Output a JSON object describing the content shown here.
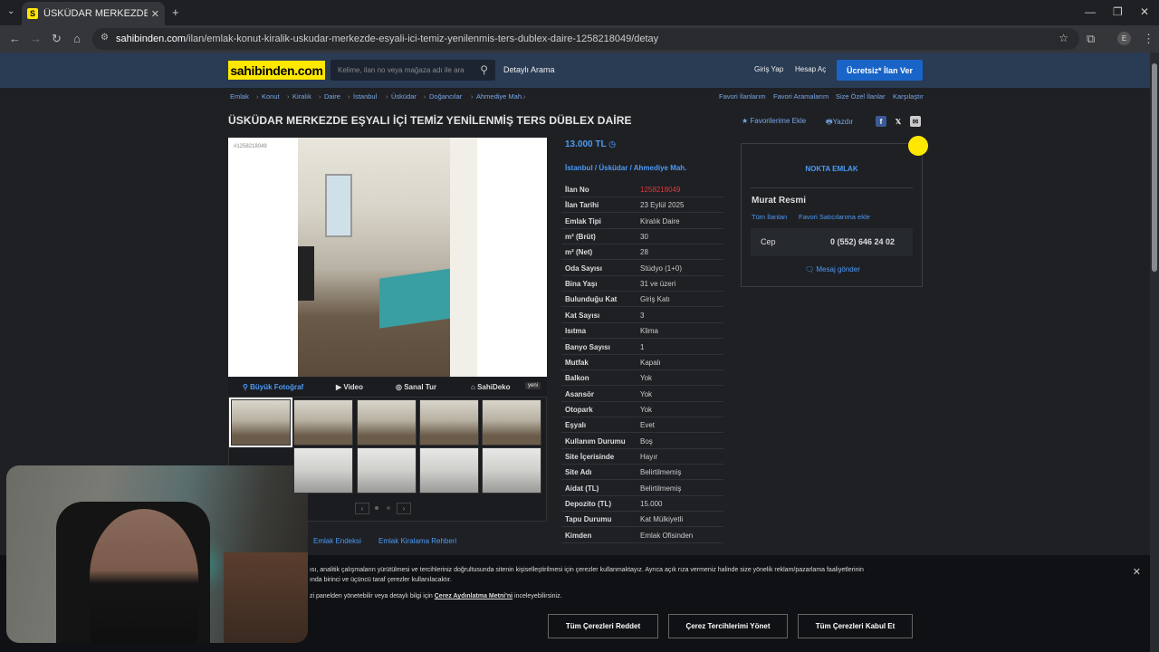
{
  "browser": {
    "tab_title": "ÜSKÜDAR MERKEZDE EŞYALI İÇ",
    "tab_favicon": "S",
    "url_host": "sahibinden.com",
    "url_path": "/ilan/emlak-konut-kiralik-uskudar-merkezde-esyali-ici-temiz-yenilenmis-ters-dublex-daire-1258218049/detay",
    "profile_initial": "E"
  },
  "header": {
    "logo": "sahibinden.com",
    "search_placeholder": "Kelime, ilan no veya mağaza adı ile ara",
    "detailed_search": "Detaylı Arama",
    "login": "Giriş Yap",
    "register": "Hesap Aç",
    "post_ad": "Ücretsiz* İlan Ver"
  },
  "breadcrumb": [
    "Emlak",
    "Konut",
    "Kiralık",
    "Daire",
    "İstanbul",
    "Üsküdar",
    "Doğancılar",
    "Ahmediye Mah."
  ],
  "breadcrumb_right": [
    "Favori İlanlarım",
    "Favori Aramalarım",
    "Size Özel İlanlar",
    "Karşılaştır"
  ],
  "listing": {
    "title": "ÜSKÜDAR MERKEZDE EŞYALI İÇİ TEMİZ YENİLENMİŞ TERS DÜBLEX DAİRE",
    "add_favorite": "Favorilerime Ekle",
    "print": "Yazdır",
    "photo_id": "#1258218049",
    "photo_tabs": {
      "big_photo": "Büyük Fotoğraf",
      "video": "Video",
      "virtual_tour": "Sanal Tur",
      "sahideko": "SahiDeko",
      "new_badge": "yeni"
    },
    "price": "13.000 TL",
    "location": [
      "İstanbul",
      "Üsküdar",
      "Ahmediye Mah."
    ],
    "details": [
      {
        "key": "İlan No",
        "value": "1258218049"
      },
      {
        "key": "İlan Tarihi",
        "value": "23 Eylül 2025"
      },
      {
        "key": "Emlak Tipi",
        "value": "Kiralık Daire"
      },
      {
        "key": "m² (Brüt)",
        "value": "30"
      },
      {
        "key": "m² (Net)",
        "value": "28"
      },
      {
        "key": "Oda Sayısı",
        "value": "Stüdyo (1+0)"
      },
      {
        "key": "Bina Yaşı",
        "value": "31 ve üzeri"
      },
      {
        "key": "Bulunduğu Kat",
        "value": "Giriş Katı"
      },
      {
        "key": "Kat Sayısı",
        "value": "3"
      },
      {
        "key": "Isıtma",
        "value": "Klima"
      },
      {
        "key": "Banyo Sayısı",
        "value": "1"
      },
      {
        "key": "Mutfak",
        "value": "Kapalı"
      },
      {
        "key": "Balkon",
        "value": "Yok"
      },
      {
        "key": "Asansör",
        "value": "Yok"
      },
      {
        "key": "Otopark",
        "value": "Yok"
      },
      {
        "key": "Eşyalı",
        "value": "Evet"
      },
      {
        "key": "Kullanım Durumu",
        "value": "Boş"
      },
      {
        "key": "Site İçerisinde",
        "value": "Hayır"
      },
      {
        "key": "Site Adı",
        "value": "Belirtilmemiş"
      },
      {
        "key": "Aidat (TL)",
        "value": "Belirtilmemiş"
      },
      {
        "key": "Depozito (TL)",
        "value": "15.000"
      },
      {
        "key": "Tapu Durumu",
        "value": "Kat Mülkiyetli"
      },
      {
        "key": "Kimden",
        "value": "Emlak Ofisinden"
      }
    ],
    "links": [
      "Emlak Endeksi",
      "Emlak Kiralama Rehberi"
    ]
  },
  "seller": {
    "store": "NOKTA EMLAK",
    "name": "Murat Resmi",
    "all_ads": "Tüm İlanları",
    "favorite_seller": "Favori Satıcılarıma ekle",
    "phone_label": "Cep",
    "phone": "0 (552) 646 24 02",
    "message": "Mesaj gönder"
  },
  "cookie": {
    "line1": "ısı, analitik çalışmaların yürütülmesi ve tercihleriniz doğrultusunda sitenin kişiselleştirilmesi için çerezler kullanmaktayız. Ayrıca açık rıza vermeniz halinde size yönelik reklam/pazarlama faaliyetlerinin",
    "line2": "ında birinci ve üçüncü taraf çerezler kullanılacaktır.",
    "line3_pre": "zi panelden yönetebilir veya detaylı bilgi için ",
    "line3_link": "Çerez Aydınlatma Metni'ni",
    "line3_post": " inceleyebilirsiniz.",
    "reject": "Tüm Çerezleri Reddet",
    "manage": "Çerez Tercihlerimi Yönet",
    "accept": "Tüm Çerezleri Kabul Et"
  },
  "colors": {
    "brand_yellow": "#ffe800",
    "link_blue": "#4d9af5",
    "header_bg": "#2a3b54",
    "post_btn": "#1964c8",
    "ad_no_red": "#e0383b"
  }
}
